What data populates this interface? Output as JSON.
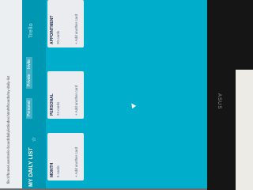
{
  "browser": {
    "url": "file:///home/user/trello-board/dailylist/index.html#/boards/my-daily-list"
  },
  "board": {
    "title": "MY DAILY LIST",
    "visibility_label": "Personal",
    "private_label": "Private",
    "invite_label": "Invite",
    "logo_text": "Trello"
  },
  "lists": [
    {
      "title": "MONTH",
      "count": "5 cards",
      "add_label": "+ Add another card"
    },
    {
      "title": "PERSONAL",
      "count": "24 cards",
      "add_label": "+ Add another card"
    },
    {
      "title": "APPOINTMENT",
      "count": "20 cards",
      "add_label": "+ Add another card"
    }
  ],
  "colors": {
    "board_background": "#00aecc",
    "header_background": "#0097b3",
    "list_background": "#ebecf0"
  },
  "icons": {
    "star": "star-icon",
    "menu": "more-icon",
    "cursor": "mouse-cursor-icon"
  },
  "monitor": {
    "brand_label": "ASUS"
  }
}
